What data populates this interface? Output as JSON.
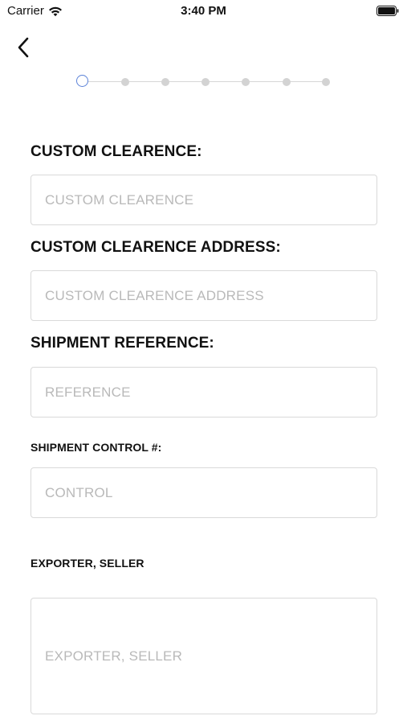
{
  "status_bar": {
    "carrier": "Carrier",
    "time": "3:40 PM"
  },
  "navigation": {
    "back_icon": "chevron-left-icon"
  },
  "stepper": {
    "total_steps": 7,
    "current_step": 1,
    "active_color": "#5b82d8",
    "inactive_color": "#d3d3d3"
  },
  "form": {
    "custom_clearence": {
      "label": "CUSTOM CLEARENCE:",
      "placeholder": "CUSTOM CLEARENCE",
      "value": ""
    },
    "custom_clearence_address": {
      "label": "CUSTOM CLEARENCE ADDRESS:",
      "placeholder": "CUSTOM CLEARENCE ADDRESS",
      "value": ""
    },
    "shipment_reference": {
      "label": "SHIPMENT REFERENCE:",
      "placeholder": "REFERENCE",
      "value": ""
    },
    "shipment_control": {
      "label": "SHIPMENT CONTROL #:",
      "placeholder": "CONTROL",
      "value": ""
    },
    "exporter_seller": {
      "label": "EXPORTER, SELLER",
      "placeholder": "EXPORTER, SELLER",
      "value": ""
    }
  }
}
